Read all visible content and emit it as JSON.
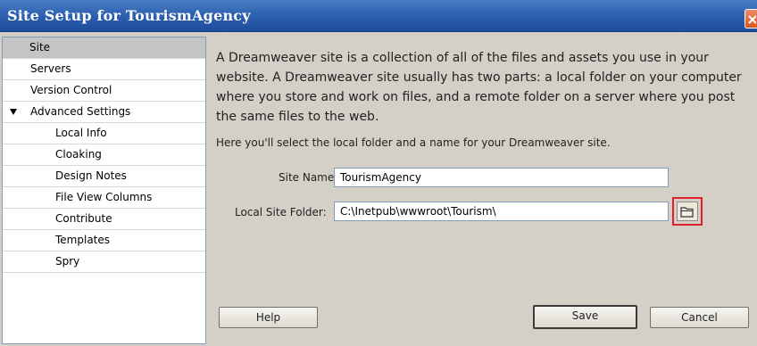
{
  "window": {
    "title": "Site Setup for TourismAgency"
  },
  "sidebar": {
    "items": [
      {
        "label": "Site",
        "selected": true
      },
      {
        "label": "Servers"
      },
      {
        "label": "Version Control"
      },
      {
        "label": "Advanced Settings",
        "expanded": true
      },
      {
        "label": "Local Info"
      },
      {
        "label": "Cloaking"
      },
      {
        "label": "Design Notes"
      },
      {
        "label": "File View Columns"
      },
      {
        "label": "Contribute"
      },
      {
        "label": "Templates"
      },
      {
        "label": "Spry"
      }
    ]
  },
  "main": {
    "description": "A Dreamweaver site is a collection of all of the files and assets you use in your website. A Dreamweaver site usually has two parts: a local folder on your computer where you store and work on files, and a remote folder on a server where you post the same files to the web.",
    "subtext": "Here you'll select the local folder and a name for your Dreamweaver site.",
    "site_name": {
      "label": "Site Name:",
      "value": "TourismAgency"
    },
    "local_folder": {
      "label": "Local Site Folder:",
      "value": "C:\\Inetpub\\wwwroot\\Tourism\\"
    },
    "browse_icon": "folder-icon",
    "highlight_color": "#e0202a"
  },
  "buttons": {
    "help": "Help",
    "save": "Save",
    "cancel": "Cancel"
  }
}
